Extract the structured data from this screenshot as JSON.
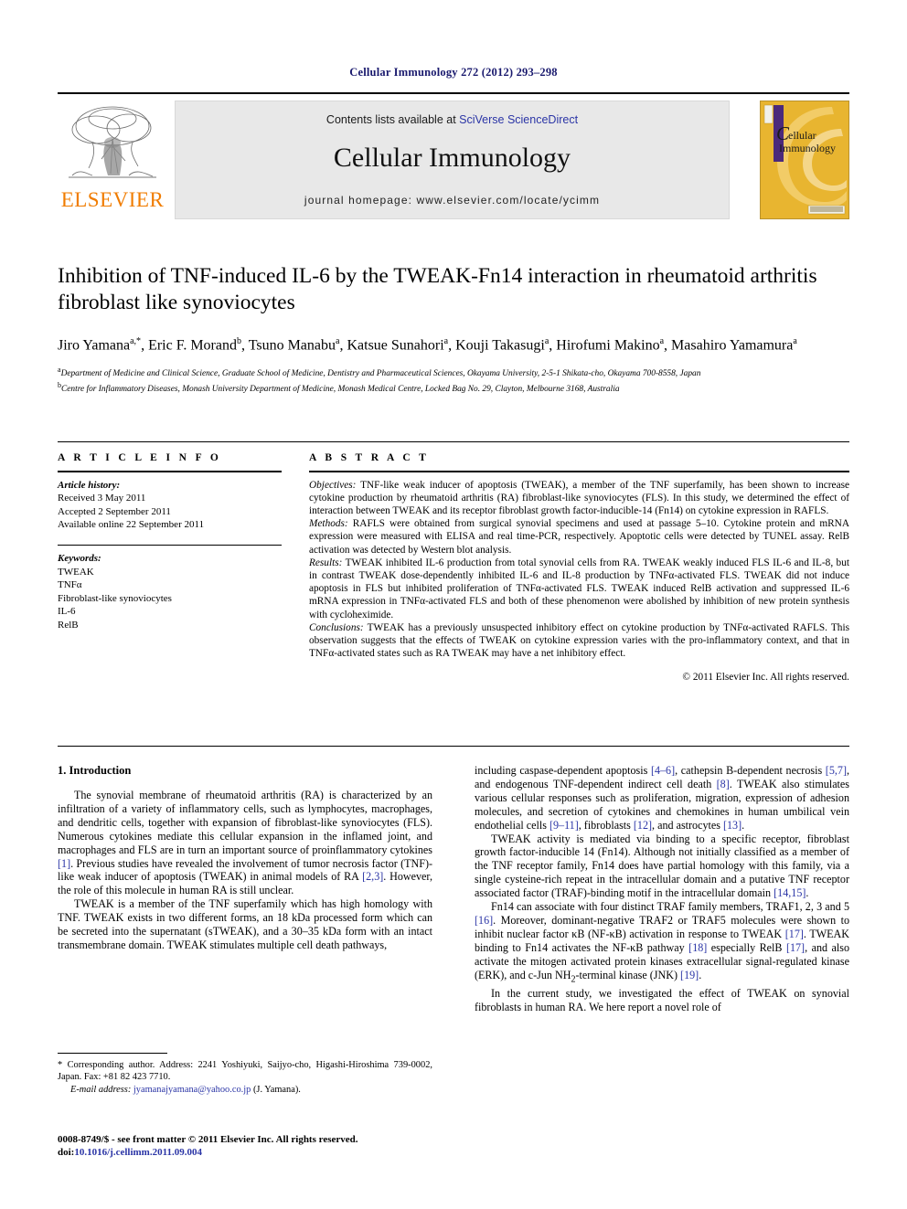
{
  "running_head": "Cellular Immunology 272 (2012) 293–298",
  "masthead": {
    "contents_prefix": "Contents lists available at ",
    "sciencedirect_link": "SciVerse ScienceDirect",
    "journal_name": "Cellular Immunology",
    "homepage": "journal homepage: www.elsevier.com/locate/ycimm",
    "publisher_logo_text": "ELSEVIER",
    "cover_title_line1": "ellular",
    "cover_title_line2": "Immunology",
    "cover_initial": "C",
    "colors": {
      "link": "#2b35a6",
      "elsevier_orange": "#F07C00",
      "cover_gold": "#E8B530",
      "cover_purple": "#4B2A7B",
      "banner_grey": "#e8e8e8"
    }
  },
  "article": {
    "title": "Inhibition of TNF-induced IL-6 by the TWEAK-Fn14 interaction in rheumatoid arthritis fibroblast like synoviocytes",
    "authors": "Jiro Yamana a,*, Eric F. Morand b, Tsuno Manabu a, Katsue Sunahori a, Kouji Takasugi a, Hirofumi Makino a, Masahiro Yamamura a",
    "affiliation_a": "a Department of Medicine and Clinical Science, Graduate School of Medicine, Dentistry and Pharmaceutical Sciences, Okayama University, 2-5-1 Shikata-cho, Okayama 700-8558, Japan",
    "affiliation_b": "b Centre for Inflammatory Diseases, Monash University Department of Medicine, Monash Medical Centre, Locked Bag No. 29, Clayton, Melbourne 3168, Australia"
  },
  "article_info": {
    "heading": "A R T I C L E   I N F O",
    "history_label": "Article history:",
    "history": [
      "Received 3 May 2011",
      "Accepted 2 September 2011",
      "Available online 22 September 2011"
    ],
    "keywords_label": "Keywords:",
    "keywords": [
      "TWEAK",
      "TNFα",
      "Fibroblast-like synoviocytes",
      "IL-6",
      "RelB"
    ]
  },
  "abstract": {
    "heading": "A B S T R A C T",
    "objectives_label": "Objectives:",
    "objectives": "TNF-like weak inducer of apoptosis (TWEAK), a member of the TNF superfamily, has been shown to increase cytokine production by rheumatoid arthritis (RA) fibroblast-like synoviocytes (FLS). In this study, we determined the effect of interaction between TWEAK and its receptor fibroblast growth factor-inducible-14 (Fn14) on cytokine expression in RAFLS.",
    "methods_label": "Methods:",
    "methods": "RAFLS were obtained from surgical synovial specimens and used at passage 5–10. Cytokine protein and mRNA expression were measured with ELISA and real time-PCR, respectively. Apoptotic cells were detected by TUNEL assay. RelB activation was detected by Western blot analysis.",
    "results_label": "Results:",
    "results": "TWEAK inhibited IL-6 production from total synovial cells from RA. TWEAK weakly induced FLS IL-6 and IL-8, but in contrast TWEAK dose-dependently inhibited IL-6 and IL-8 production by TNFα-activated FLS. TWEAK did not induce apoptosis in FLS but inhibited proliferation of TNFα-activated FLS. TWEAK induced RelB activation and suppressed IL-6 mRNA expression in TNFα-activated FLS and both of these phenomenon were abolished by inhibition of new protein synthesis with cycloheximide.",
    "conclusions_label": "Conclusions:",
    "conclusions": "TWEAK has a previously unsuspected inhibitory effect on cytokine production by TNFα-activated RAFLS. This observation suggests that the effects of TWEAK on cytokine expression varies with the pro-inflammatory context, and that in TNFα-activated states such as RA TWEAK may have a net inhibitory effect.",
    "copyright": "© 2011 Elsevier Inc. All rights reserved."
  },
  "body": {
    "section_title": "1. Introduction",
    "left_paragraphs": [
      "The synovial membrane of rheumatoid arthritis (RA) is characterized by an infiltration of a variety of inflammatory cells, such as lymphocytes, macrophages, and dendritic cells, together with expansion of fibroblast-like synoviocytes (FLS). Numerous cytokines mediate this cellular expansion in the inflamed joint, and macrophages and FLS are in turn an important source of proinflammatory cytokines [1]. Previous studies have revealed the involvement of tumor necrosis factor (TNF)-like weak inducer of apoptosis (TWEAK) in animal models of RA [2,3]. However, the role of this molecule in human RA is still unclear.",
      "TWEAK is a member of the TNF superfamily which has high homology with TNF. TWEAK exists in two different forms, an 18 kDa processed form which can be secreted into the supernatant (sTWEAK), and a 30–35 kDa form with an intact transmembrane domain. TWEAK stimulates multiple cell death pathways,"
    ],
    "right_paragraphs": [
      "including caspase-dependent apoptosis [4–6], cathepsin B-dependent necrosis [5,7], and endogenous TNF-dependent indirect cell death [8]. TWEAK also stimulates various cellular responses such as proliferation, migration, expression of adhesion molecules, and secretion of cytokines and chemokines in human umbilical vein endothelial cells [9–11], fibroblasts [12], and astrocytes [13].",
      "TWEAK activity is mediated via binding to a specific receptor, fibroblast growth factor-inducible 14 (Fn14). Although not initially classified as a member of the TNF receptor family, Fn14 does have partial homology with this family, via a single cysteine-rich repeat in the intracellular domain and a putative TNF receptor associated factor (TRAF)-binding motif in the intracellular domain [14,15].",
      "Fn14 can associate with four distinct TRAF family members, TRAF1, 2, 3 and 5 [16]. Moreover, dominant-negative TRAF2 or TRAF5 molecules were shown to inhibit nuclear factor κB (NF-κB) activation in response to TWEAK [17]. TWEAK binding to Fn14 activates the NF-κB pathway [18] especially RelB [17], and also activate the mitogen activated protein kinases extracellular signal-regulated kinase (ERK), and c-Jun NH2-terminal kinase (JNK) [19].",
      "In the current study, we investigated the effect of TWEAK on synovial fibroblasts in human RA. We here report a novel role of"
    ]
  },
  "footnote": {
    "corresponding": "* Corresponding author. Address: 2241 Yoshiyuki, Saijyo-cho, Higashi-Hiroshima 739-0002, Japan. Fax: +81 82 423 7710.",
    "email_label": "E-mail address:",
    "email": "jyamanajyamana@yahoo.co.jp",
    "email_suffix": "(J. Yamana)."
  },
  "imprint": {
    "issn_line": "0008-8749/$ - see front matter © 2011 Elsevier Inc. All rights reserved.",
    "doi_label": "doi:",
    "doi": "10.1016/j.cellimm.2011.09.004"
  }
}
